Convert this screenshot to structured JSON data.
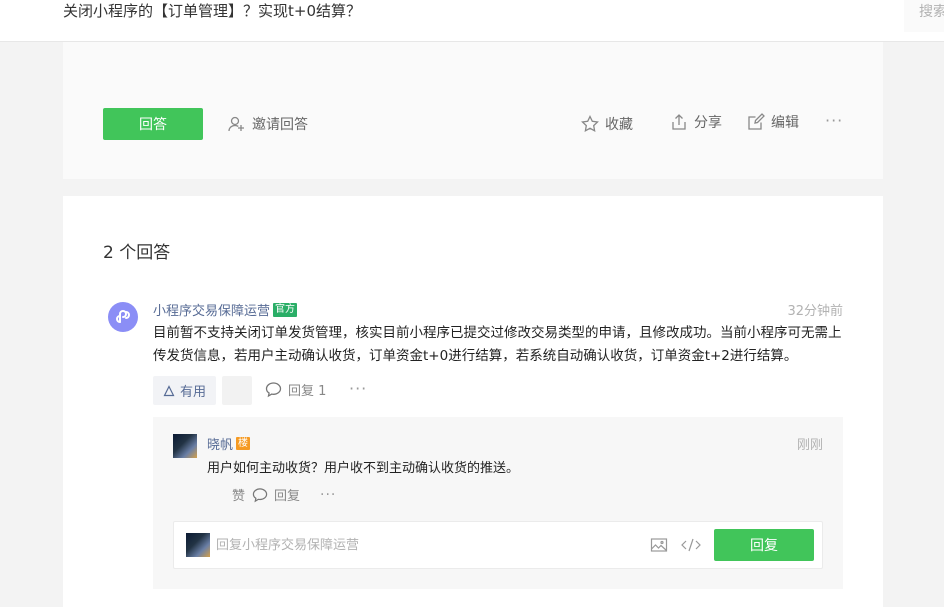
{
  "header": {
    "title": "关闭小程序的【订单管理】？实现t+0结算？",
    "search_placeholder": "搜索"
  },
  "question_actions": {
    "answer_label": "回答",
    "invite_label": "邀请回答",
    "collect_label": "收藏",
    "share_label": "分享",
    "edit_label": "编辑",
    "more_label": "···"
  },
  "answers": {
    "count_label": "2 个回答",
    "items": [
      {
        "author": "小程序交易保障运营",
        "badge": "官方",
        "time": "32分钟前",
        "content": "目前暂不支持关闭订单发货管理，核实目前小程序已提交过修改交易类型的申请，且修改成功。当前小程序可无需上传发货信息，若用户主动确认收货，订单资金t+0进行结算，若系统自动确认收货，订单资金t+2进行结算。",
        "useful_label": "有用",
        "reply_label": "回复 1",
        "more_label": "···",
        "replies": [
          {
            "author": "晓帆",
            "badge": "楼",
            "time": "刚刚",
            "content": "用户如何主动收货？用户收不到主动确认收货的推送。",
            "like_label": "赞",
            "reply_label": "回复",
            "more_label": "···"
          }
        ],
        "reply_box": {
          "placeholder": "回复小程序交易保障运营",
          "value": "",
          "submit_label": "回复"
        }
      }
    ]
  },
  "colors": {
    "brand_green": "#41c55a",
    "link_blue": "#576b95",
    "official_badge": "#2aae67",
    "lz_badge": "#f59a23",
    "avatar_purple": "#8b8ef6"
  },
  "icons": [
    "add-user-icon",
    "star-icon",
    "share-icon",
    "edit-icon",
    "more-icon",
    "thumb-up-icon",
    "comment-icon",
    "image-icon",
    "code-icon",
    "mini-program-icon"
  ]
}
